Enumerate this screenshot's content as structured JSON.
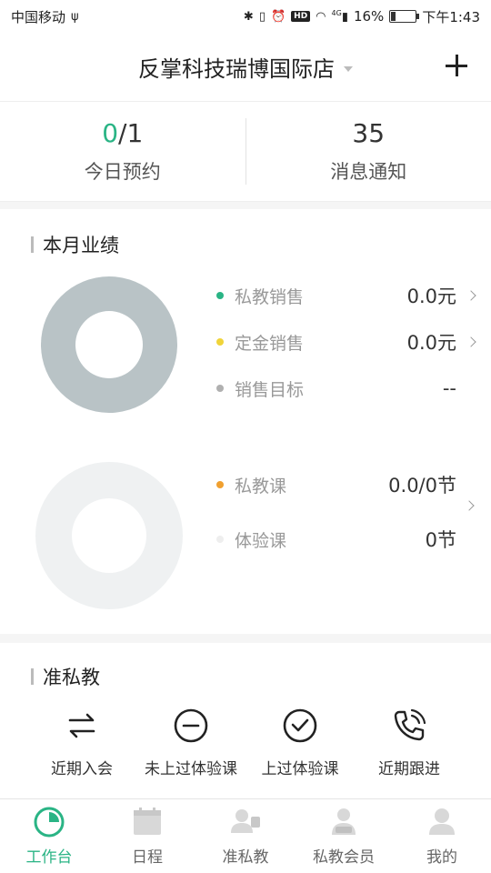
{
  "statusbar": {
    "carrier": "中国移动",
    "battery": "16%",
    "time": "下午1:43",
    "network": "4G",
    "hd": "HD"
  },
  "header": {
    "title": "反掌科技瑞博国际店"
  },
  "stats": {
    "appointments_done": "0",
    "appointments_total": "/1",
    "appointments_label": "今日预约",
    "messages_count": "35",
    "messages_label": "消息通知"
  },
  "performance": {
    "title": "本月业绩",
    "sales": [
      {
        "label": "私教销售",
        "value": "0.0元",
        "color": "#2ab485"
      },
      {
        "label": "定金销售",
        "value": "0.0元",
        "color": "#f0d43a"
      },
      {
        "label": "销售目标",
        "value": "--",
        "color": "#b0b0b0"
      }
    ],
    "classes": [
      {
        "label": "私教课",
        "value": "0.0/0节",
        "color": "#f0a030"
      },
      {
        "label": "体验课",
        "value": "0节",
        "color": "#eeeeee"
      }
    ]
  },
  "prospects": {
    "title": "准私教",
    "items": [
      {
        "label": "近期入会",
        "icon": "swap-arrows-icon"
      },
      {
        "label": "未上过体验课",
        "icon": "minus-circle-icon"
      },
      {
        "label": "上过体验课",
        "icon": "check-circle-icon"
      },
      {
        "label": "近期跟进",
        "icon": "phone-call-icon"
      }
    ]
  },
  "tabbar": {
    "items": [
      {
        "label": "工作台",
        "icon": "dashboard-icon",
        "active": true
      },
      {
        "label": "日程",
        "icon": "calendar-icon",
        "active": false
      },
      {
        "label": "准私教",
        "icon": "prospects-icon",
        "active": false
      },
      {
        "label": "私教会员",
        "icon": "vip-member-icon",
        "active": false
      },
      {
        "label": "我的",
        "icon": "profile-icon",
        "active": false
      }
    ]
  },
  "colors": {
    "accent": "#2ab485",
    "donut_main": "#b9c3c6",
    "donut_empty": "#eff1f2"
  }
}
